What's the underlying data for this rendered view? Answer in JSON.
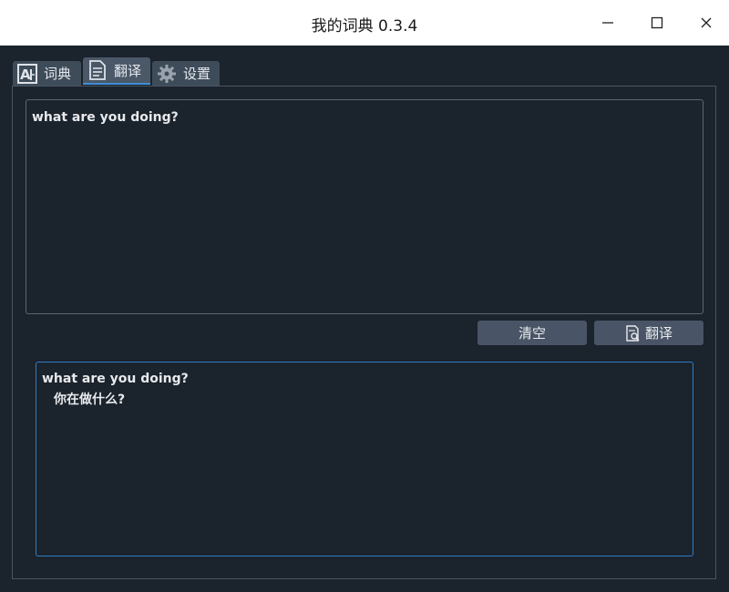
{
  "window": {
    "title": "我的词典 0.3.4",
    "minimize": "—",
    "maximize": "☐",
    "close": "✕"
  },
  "tabs": [
    {
      "label": "词典",
      "icon": "dictionary-icon"
    },
    {
      "label": "翻译",
      "icon": "document-icon",
      "active": true
    },
    {
      "label": "设置",
      "icon": "gear-icon"
    }
  ],
  "translate": {
    "input_text": "what are you doing?",
    "clear_label": "清空",
    "translate_label": "翻译",
    "output_source": "what are you doing?",
    "output_translation": "你在做什么?"
  },
  "colors": {
    "background": "#1b232c",
    "tab": "#3e4b59",
    "button": "#495566",
    "accent": "#2f7ec7"
  }
}
